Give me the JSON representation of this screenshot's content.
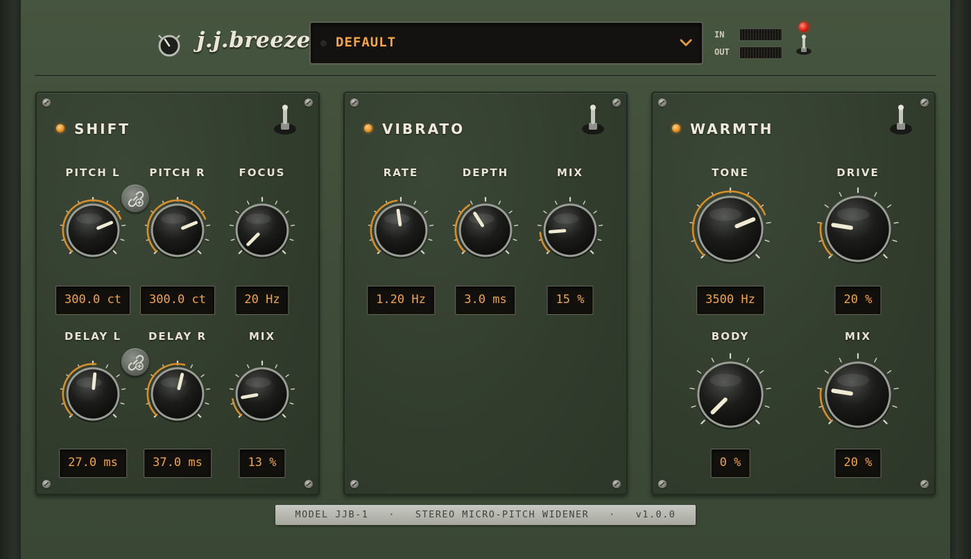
{
  "header": {
    "brand": "j.j.breeze",
    "logo_icon": "knob-logo-icon",
    "preset": {
      "name": "DEFAULT",
      "chevron_icon": "chevron-down-icon"
    },
    "meters": {
      "in_label": "IN",
      "out_label": "OUT"
    },
    "power_led_color": "#e01e10"
  },
  "colors": {
    "accent": "#f2a446",
    "arc": "#d88f2a",
    "panel": "#343f30",
    "indicator": "#f1ead2"
  },
  "panels": {
    "shift": {
      "title": "SHIFT",
      "knobs": {
        "pitch_l": {
          "label": "PITCH L",
          "value": "300.0 ct",
          "fraction": 0.75
        },
        "pitch_r": {
          "label": "PITCH R",
          "value": "300.0 ct",
          "fraction": 0.75
        },
        "focus": {
          "label": "FOCUS",
          "value": "20 Hz",
          "fraction": 0.0
        },
        "delay_l": {
          "label": "DELAY L",
          "value": "27.0 ms",
          "fraction": 0.52
        },
        "delay_r": {
          "label": "DELAY R",
          "value": "37.0 ms",
          "fraction": 0.55
        },
        "mix": {
          "label": "MIX",
          "value": "13 %",
          "fraction": 0.13
        }
      },
      "link_icon": "link-icon"
    },
    "vibrato": {
      "title": "VIBRATO",
      "knobs": {
        "rate": {
          "label": "RATE",
          "value": "1.20 Hz",
          "fraction": 0.47
        },
        "depth": {
          "label": "DEPTH",
          "value": "3.0 ms",
          "fraction": 0.38
        },
        "mix": {
          "label": "MIX",
          "value": "15 %",
          "fraction": 0.15
        }
      }
    },
    "warmth": {
      "title": "WARMTH",
      "knobs": {
        "tone": {
          "label": "TONE",
          "value": "3500 Hz",
          "fraction": 0.75
        },
        "drive": {
          "label": "DRIVE",
          "value": "20 %",
          "fraction": 0.2
        },
        "body": {
          "label": "BODY",
          "value": "0 %",
          "fraction": 0.0
        },
        "mix": {
          "label": "MIX",
          "value": "20 %",
          "fraction": 0.2
        }
      }
    }
  },
  "footer": {
    "model": "MODEL JJB-1",
    "sep": "·",
    "description": "STEREO MICRO-PITCH WIDENER",
    "version": "v1.0.0"
  }
}
